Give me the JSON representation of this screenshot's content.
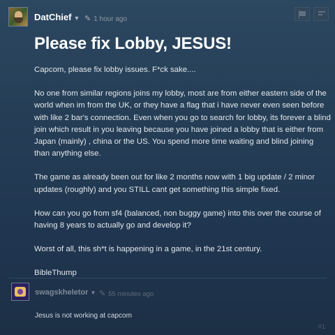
{
  "post": {
    "author": "DatChief",
    "caret": "▼",
    "time": "1 hour ago",
    "title": "Please fix Lobby, JESUS!",
    "paragraphs": [
      "Capcom, please fix lobby issues. F*ck sake....",
      "No one from similar regions joins my lobby, most are from either eastern side of the world when im from the UK, or they have a flag that i have never even seen before with like 2 bar's connection. Even when you go to search for lobby, its forever a blind join which result in you leaving because you have joined a lobby that is either from Japan (mainly) , china or the US. You spend more time waiting and blind joining than anything else.",
      "The game as already been out for like 2 months now with 1 big update / 2 minor updates (roughly) and you STILL cant get something this simple fixed.",
      "How can you go from sf4 (balanced, non buggy game) into this over the course of having 8 years to actually go and develop it?",
      "Worst of all, this sh*t is happening in a game, in the 21st century.",
      "BibleThump"
    ]
  },
  "reply": {
    "author": "swagskheletor",
    "caret": "▼",
    "time": "55 minutes ago",
    "text": "Jesus is not working at capcom",
    "number": "#1"
  },
  "icons": {
    "pencil": "✎"
  },
  "colors": {
    "background": "#2c4760",
    "title": "#ffffff",
    "body_text": "#e3e8ec",
    "muted": "#8f98a0"
  }
}
